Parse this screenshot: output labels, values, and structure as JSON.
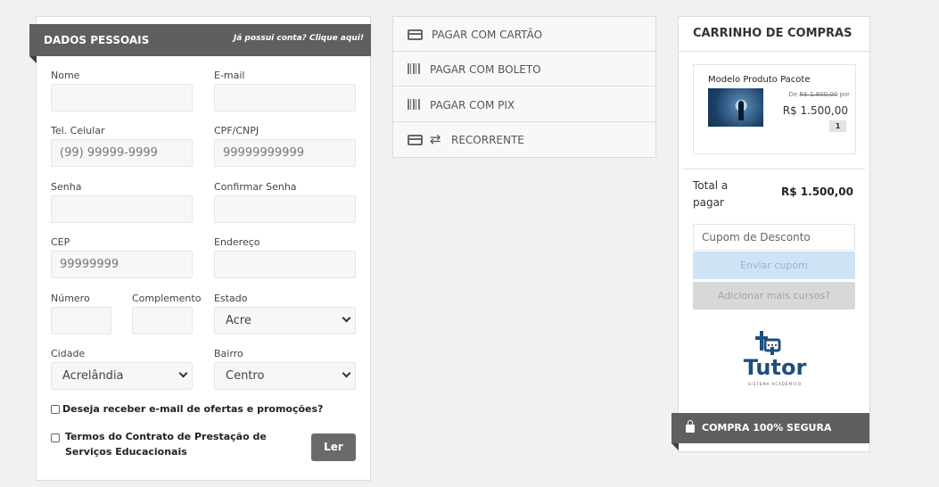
{
  "dados": {
    "title": "DADOS PESSOAIS",
    "login_link": "Já possui conta? Clique aqui!",
    "fields": {
      "nome": {
        "label": "Nome",
        "placeholder": ""
      },
      "email": {
        "label": "E-mail",
        "placeholder": ""
      },
      "celular": {
        "label": "Tel. Celular",
        "placeholder": "(99) 99999-9999"
      },
      "cpf": {
        "label": "CPF/CNPJ",
        "placeholder": "99999999999"
      },
      "senha": {
        "label": "Senha",
        "placeholder": ""
      },
      "confirmar": {
        "label": "Confirmar Senha",
        "placeholder": ""
      },
      "cep": {
        "label": "CEP",
        "placeholder": "99999999"
      },
      "endereco": {
        "label": "Endereço",
        "placeholder": ""
      },
      "numero": {
        "label": "Número",
        "placeholder": ""
      },
      "complemento": {
        "label": "Complemento",
        "placeholder": ""
      },
      "estado": {
        "label": "Estado",
        "value": "Acre"
      },
      "cidade": {
        "label": "Cidade",
        "value": "Acrelândia"
      },
      "bairro": {
        "label": "Bairro",
        "value": "Centro"
      }
    },
    "newsletter": "Deseja receber e-mail de ofertas e promoções?",
    "termos": "Termos do Contrato de Prestação de Serviços Educacionais",
    "ler": "Ler"
  },
  "payment": {
    "cartao": "PAGAR COM CARTÃO",
    "boleto": "PAGAR COM BOLETO",
    "pix": "PAGAR COM PIX",
    "recorrente": "RECORRENTE"
  },
  "cart": {
    "title": "CARRINHO DE COMPRAS",
    "product": {
      "name": "Modelo Produto Pacote",
      "old_prefix": "De",
      "old_price": "R$ 1.800,00",
      "old_suffix": "por",
      "price": "R$ 1.500,00",
      "qty": "1"
    },
    "total_label": "Total a pagar",
    "total_value": "R$ 1.500,00",
    "coupon_placeholder": "Cupom de Desconto",
    "send_coupon": "Enviar cupom",
    "add_courses": "Adicionar mais cursos?",
    "logo_word": "Tutor",
    "logo_sub": "SISTEMA ACADÊMICO",
    "secure": "COMPRA 100% SEGURA"
  },
  "colors": {
    "band": "#5f5f5f",
    "coupon_button": "#cfe3f6",
    "logo": "#1d4f7e"
  }
}
